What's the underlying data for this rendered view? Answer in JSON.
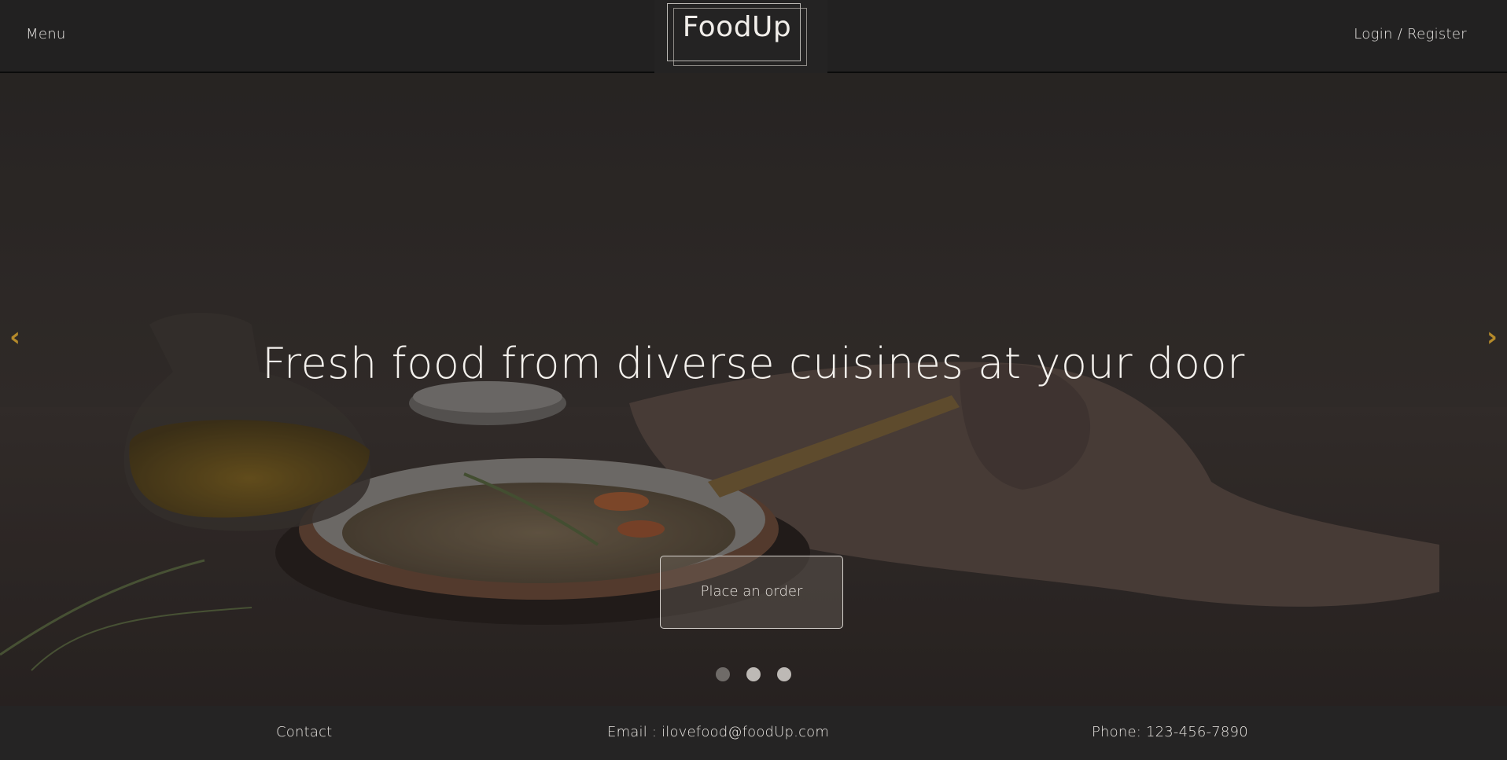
{
  "header": {
    "menu_label": "Menu",
    "logo_text": "FoodUp",
    "login_label": "Login / Register"
  },
  "hero": {
    "headline": "Fresh food from diverse cuisines at your door",
    "cta_label": "Place an order",
    "prev_arrow": "‹",
    "next_arrow": "›",
    "slides_total": 3,
    "active_slide": 1
  },
  "footer": {
    "contact_label": "Contact",
    "email_text": "Email : ilovefood@foodUp.com",
    "phone_text": "Phone: 123-456-7890"
  },
  "colors": {
    "accent_arrow": "#b58a2a",
    "header_bg": "#222121",
    "footer_bg": "#252424"
  }
}
